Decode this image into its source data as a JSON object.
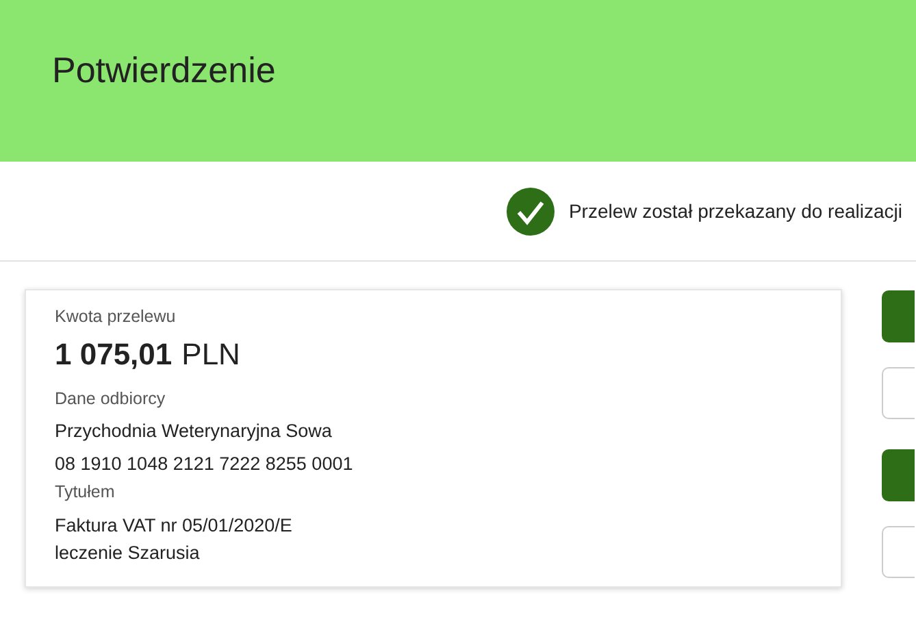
{
  "header": {
    "title": "Potwierdzenie"
  },
  "status": {
    "kind": "success",
    "message": "Przelew został przekazany do realizacji"
  },
  "summary": {
    "amount_label": "Kwota przelewu",
    "amount": "1 075,01",
    "currency": "PLN",
    "recipient_label": "Dane odbiorcy",
    "recipient_name": "Przychodnia Weterynaryjna Sowa",
    "account": "08 1910 1048 2121 7222 8255 0001",
    "title_label": "Tytułem",
    "title_lines": [
      "Faktura VAT nr 05/01/2020/E",
      "leczenie Szarusia"
    ]
  },
  "actions": [
    {
      "kind": "primary"
    },
    {
      "kind": "secondary"
    },
    {
      "kind": "primary"
    },
    {
      "kind": "secondary"
    }
  ]
}
